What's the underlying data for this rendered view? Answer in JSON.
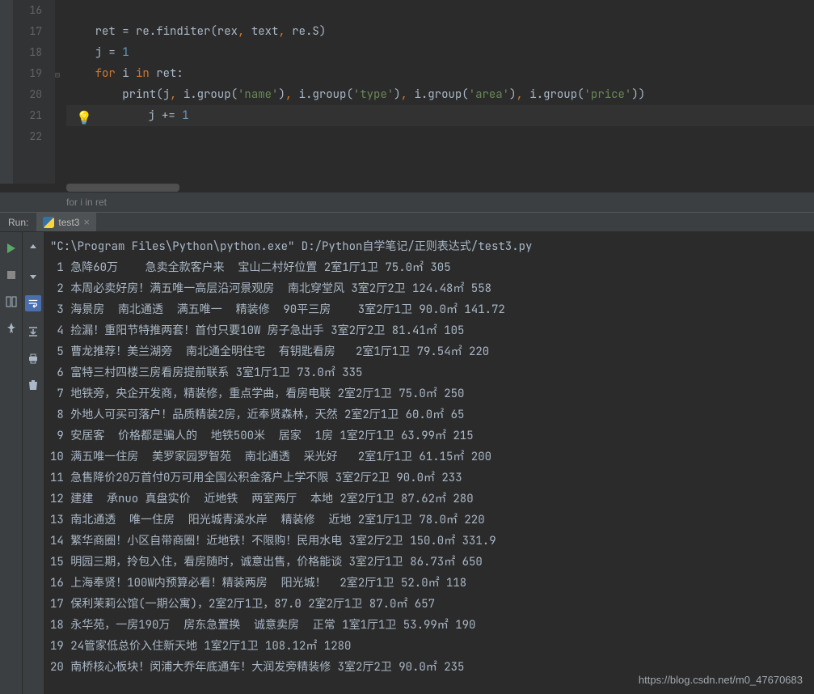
{
  "editor": {
    "line_start": 16,
    "lines": [
      {
        "n": 16,
        "seg": []
      },
      {
        "n": 17,
        "seg": [
          {
            "t": "    ",
            "c": "op"
          },
          {
            "t": "ret = re.finditer(rex",
            "c": "id"
          },
          {
            "t": ",",
            "c": "comma"
          },
          {
            "t": " text",
            "c": "id"
          },
          {
            "t": ",",
            "c": "comma"
          },
          {
            "t": " re.S)",
            "c": "id"
          }
        ]
      },
      {
        "n": 18,
        "seg": [
          {
            "t": "    ",
            "c": "op"
          },
          {
            "t": "j = ",
            "c": "id"
          },
          {
            "t": "1",
            "c": "num"
          }
        ]
      },
      {
        "n": 19,
        "seg": [
          {
            "t": "    ",
            "c": "op"
          },
          {
            "t": "for ",
            "c": "kw"
          },
          {
            "t": "i ",
            "c": "id"
          },
          {
            "t": "in ",
            "c": "kw"
          },
          {
            "t": "ret:",
            "c": "id"
          }
        ]
      },
      {
        "n": 20,
        "seg": [
          {
            "t": "        ",
            "c": "op"
          },
          {
            "t": "print",
            "c": "call"
          },
          {
            "t": "(j",
            "c": "id"
          },
          {
            "t": ",",
            "c": "comma"
          },
          {
            "t": " i.group(",
            "c": "id"
          },
          {
            "t": "'name'",
            "c": "str"
          },
          {
            "t": ")",
            "c": "id"
          },
          {
            "t": ",",
            "c": "comma"
          },
          {
            "t": " i.group(",
            "c": "id"
          },
          {
            "t": "'type'",
            "c": "str"
          },
          {
            "t": ")",
            "c": "id"
          },
          {
            "t": ",",
            "c": "comma"
          },
          {
            "t": " i.group(",
            "c": "id"
          },
          {
            "t": "'area'",
            "c": "str"
          },
          {
            "t": ")",
            "c": "id"
          },
          {
            "t": ",",
            "c": "comma"
          },
          {
            "t": " i.group(",
            "c": "id"
          },
          {
            "t": "'price'",
            "c": "str"
          },
          {
            "t": "))",
            "c": "id"
          }
        ]
      },
      {
        "n": 21,
        "seg": [
          {
            "t": "        ",
            "c": "op"
          },
          {
            "t": "j +=",
            "c": "id"
          },
          {
            "t": " 1",
            "c": "num"
          }
        ],
        "bulb": true,
        "current": true
      },
      {
        "n": 22,
        "seg": []
      }
    ],
    "breadcrumb": "for i in ret"
  },
  "run": {
    "label": "Run:",
    "tab_name": "test3",
    "cmd": "\"C:\\Program Files\\Python\\python.exe\" D:/Python自学笔记/正则表达式/test3.py",
    "rows": [
      {
        "j": 1,
        "name": "急降60万    急卖全款客户来  宝山二村好位置",
        "type": "2室1厅1卫",
        "area": "75.0㎡",
        "price": "305"
      },
      {
        "j": 2,
        "name": "本周必卖好房！满五唯一高层沿河景观房  南北穿堂风",
        "type": "3室2厅2卫",
        "area": "124.48㎡",
        "price": "558"
      },
      {
        "j": 3,
        "name": "海景房  南北通透  满五唯一  精装修  90平三房   ",
        "type": "3室2厅1卫",
        "area": "90.0㎡",
        "price": "141.72"
      },
      {
        "j": 4,
        "name": "捡漏！重阳节特推两套！首付只要10W 房子急出手",
        "type": "3室2厅2卫",
        "area": "81.41㎡",
        "price": "105"
      },
      {
        "j": 5,
        "name": "曹龙推荐！美兰湖旁  南北通全明住宅  有钥匙看房  ",
        "type": "2室1厅1卫",
        "area": "79.54㎡",
        "price": "220"
      },
      {
        "j": 6,
        "name": "富特三村四楼三房看房提前联系",
        "type": "3室1厅1卫",
        "area": "73.0㎡",
        "price": "335"
      },
      {
        "j": 7,
        "name": "地铁旁，央企开发商，精装修，重点学曲，看房电联",
        "type": "2室2厅1卫",
        "area": "75.0㎡",
        "price": "250"
      },
      {
        "j": 8,
        "name": "外地人可买可落户！品质精装2房，近奉贤森林，天然",
        "type": "2室2厅1卫",
        "area": "60.0㎡",
        "price": "65"
      },
      {
        "j": 9,
        "name": "安居客  价格都是骗人的  地铁500米  居家  1房",
        "type": "1室2厅1卫",
        "area": "63.99㎡",
        "price": "215"
      },
      {
        "j": 10,
        "name": "满五唯一住房  美罗家园罗智苑  南北通透  采光好  ",
        "type": "2室1厅1卫",
        "area": "61.15㎡",
        "price": "200"
      },
      {
        "j": 11,
        "name": "急售降价20万首付0万可用全国公积金落户上学不限",
        "type": "3室2厅2卫",
        "area": "90.0㎡",
        "price": "233"
      },
      {
        "j": 12,
        "name": "建建  承nuo 真盘实价  近地铁  两室两厅  本地",
        "type": "2室2厅1卫",
        "area": "87.62㎡",
        "price": "280"
      },
      {
        "j": 13,
        "name": "南北通透  唯一住房  阳光城青溪水岸  精装修  近地",
        "type": "2室1厅1卫",
        "area": "78.0㎡",
        "price": "220"
      },
      {
        "j": 14,
        "name": "繁华商圈！小区自带商圈！近地铁！不限购！民用水电",
        "type": "3室2厅2卫",
        "area": "150.0㎡",
        "price": "331.9"
      },
      {
        "j": 15,
        "name": "明园三期，拎包入住，看房随时，诚意出售，价格能谈",
        "type": "3室2厅1卫",
        "area": "86.73㎡",
        "price": "650"
      },
      {
        "j": 16,
        "name": "上海奉贤！100W内预算必看！精装两房  阳光城！ ",
        "type": "2室2厅1卫",
        "area": "52.0㎡",
        "price": "118"
      },
      {
        "j": 17,
        "name": "保利茉莉公馆(一期公寓)，2室2厅1卫，87.0",
        "type": "2室2厅1卫",
        "area": "87.0㎡",
        "price": "657"
      },
      {
        "j": 18,
        "name": "永华苑，一房190万  房东急置换  诚意卖房  正常",
        "type": "1室1厅1卫",
        "area": "53.99㎡",
        "price": "190"
      },
      {
        "j": 19,
        "name": "24管家低总价入住新天地",
        "type": "1室2厅1卫",
        "area": "108.12㎡",
        "price": "1280"
      },
      {
        "j": 20,
        "name": "南桥核心板块！闵浦大乔年底通车！大润发旁精装修",
        "type": "3室2厅2卫",
        "area": "90.0㎡",
        "price": "235"
      }
    ]
  },
  "watermark": "https://blog.csdn.net/m0_47670683"
}
